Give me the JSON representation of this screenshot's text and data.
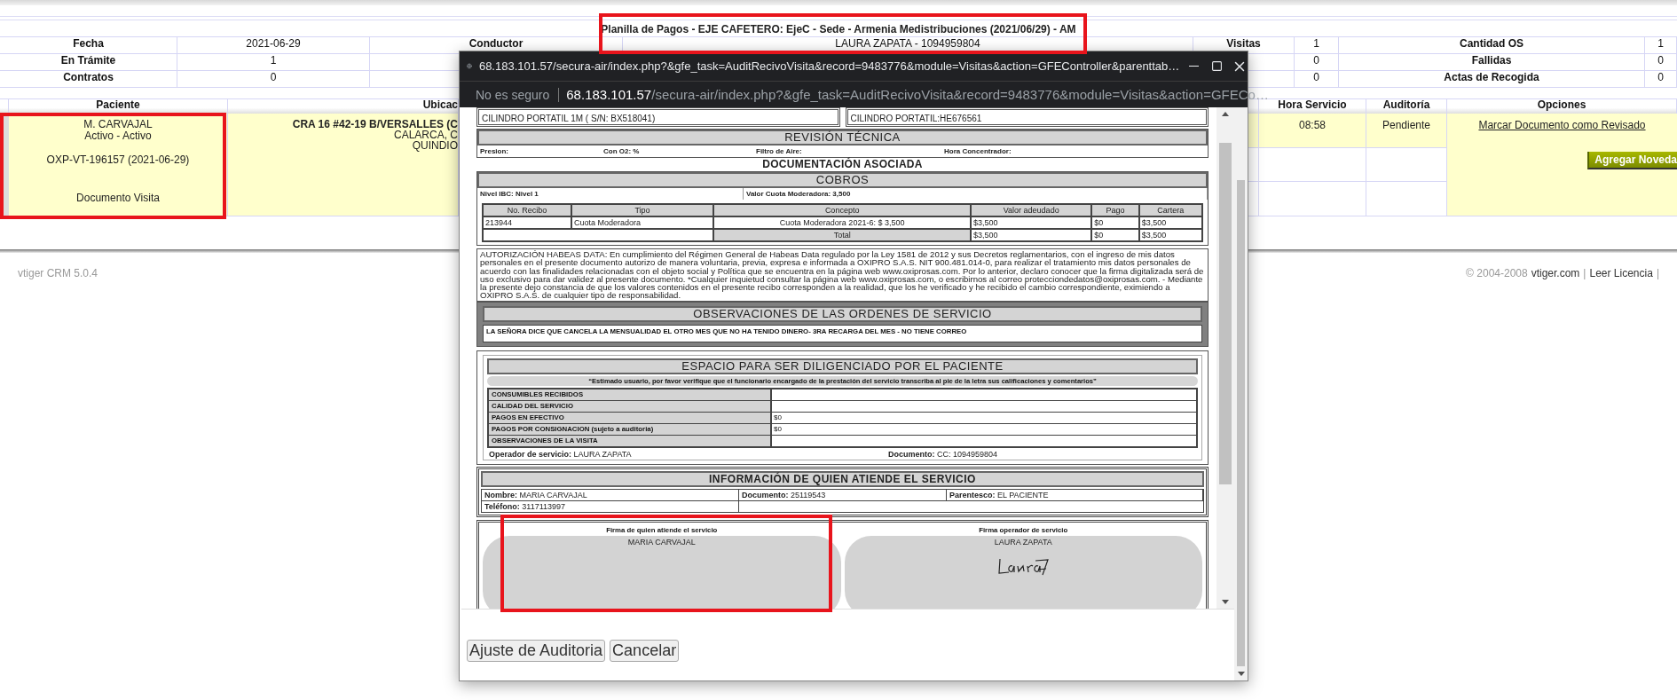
{
  "page_title": "Planilla de Pagos - EJE CAFETERO: EjeC - Sede - Armenia Medistribuciones (2021/06/29) - AM",
  "summary": {
    "rows": [
      {
        "label": "Fecha",
        "value": "2021-06-29",
        "label_2": "Conductor",
        "value_2": "LAURA ZAPATA - 1094959804",
        "label_3": "Visitas",
        "value_3": "1",
        "label_4": "Cantidad OS",
        "value_4": "1"
      },
      {
        "label": "En Trámite",
        "value": "1",
        "value_3": "0",
        "label_4": "Fallidas",
        "value_4": "0"
      },
      {
        "label": "Contratos",
        "value": "0",
        "value_3": "0",
        "label_4": "Actas de Recogida",
        "value_4": "0"
      }
    ]
  },
  "visits": {
    "columns": {
      "patient": "Paciente",
      "location": "Ubicac",
      "time": "Hora Servicio",
      "audit": "Auditoría",
      "options": "Opciones"
    },
    "row": {
      "patient": [
        "M. CARVAJAL",
        "Activo - Activo",
        "OXP-VT-196157 (2021-06-29)"
      ],
      "document_label": "Documento Visita",
      "address": [
        "CRA 16 #42-19 B/VERSALLES (C",
        "CALARCA, C",
        "QUINDIO"
      ],
      "time": "08:58",
      "audit": "Pendiente",
      "review_link": "Marcar Documento como Revisado",
      "add_button": "Agregar Noveda"
    }
  },
  "footer": {
    "version": "vtiger CRM 5.0.4",
    "right": [
      {
        "kind": "text",
        "text": "© 2004-2008"
      },
      {
        "kind": "link",
        "text": "vtiger.com"
      },
      {
        "kind": "text",
        "text": "|"
      },
      {
        "kind": "link",
        "text": "Leer Licencia"
      },
      {
        "kind": "text",
        "text": "|"
      }
    ]
  },
  "popup": {
    "title_url": "68.183.101.57/secura-air/index.php?&gfe_task=AuditRecivoVisita&record=9483776&module=Visitas&action=GFEController&parenttab…",
    "security": "No es seguro",
    "address_host": "68.183.101.57",
    "address_path": "/secura-air/index.php?&gfe_task=AuditRecivoVisita&record=9483776&module=Visitas&action=GFECo…",
    "document": {
      "equipment": [
        "CILINDRO PORTATIL 1M ( S/N: BX518041)",
        "CILINDRO PORTATIL:HE676561"
      ],
      "technical": {
        "title": "REVISIÓN TÉCNICA",
        "fields": [
          "Presion:",
          "Con O2: %",
          "Filtro de Aire:",
          "Hora Concentrador:"
        ]
      },
      "docs_title": "DOCUMENTACIÓN ASOCIADA",
      "charges": {
        "title": "COBROS",
        "level": "Nivel IBC: Nivel 1",
        "fee": "Valor Cuota Moderadora: 3,500",
        "columns": [
          "No. Recibo",
          "Tipo",
          "Concepto",
          "Valor adeudado",
          "Pago",
          "Cartera"
        ],
        "rows": [
          [
            "213944",
            "Cuota Moderadora",
            "Cuota Moderadora 2021-6: $ 3,500",
            "$3,500",
            "$0",
            "$3,500"
          ]
        ],
        "total": {
          "label": "Total",
          "values": [
            "$3,500",
            "$0",
            "$3,500"
          ]
        }
      },
      "consent": "AUTORIZACIÓN HABEAS DATA: En cumplimiento del Régimen General de Habeas Data regulado por la Ley 1581 de 2012 y sus Decretos reglamentarios, con el ingreso de mis datos personales en el presente documento autorizo de manera voluntaria, previa, expresa e informada a OXIPRO S.A.S. NIT 900.481.014-0, para realizar el tratamiento mis datos personales de acuerdo con las finalidades relacionadas con el objeto social y Política que se encuentra en la página web www.oxiprosas.com. Por lo anterior, declaro conocer que la firma digitalizada será de uso exclusivo para dar validez al presente documento. *Cualquier inquietud consultar la página web www.oxiprosas.com, o escribirnos al correo protecciondedatos@oxiprosas.com. - Mediante la presente dejo constancia de que los valores contenidos en el presente recibo corresponden a la realidad, que los he verificado y he recibido el cambio correspondiente, eximiendo a OXIPRO S.A.S. de cualquier tipo de responsabilidad.",
      "observations": {
        "title": "OBSERVACIONES DE LAS ORDENES DE SERVICIO",
        "text": "LA SEÑORA DICE QUE CANCELA LA MENSUALIDAD EL OTRO MES QUE NO HA TENIDO DINERO- 3RA RECARGA DEL MES - NO TIENE CORREO"
      },
      "patient_form": {
        "title": "ESPACIO PARA SER DILIGENCIADO POR EL PACIENTE",
        "note": "“Estimado usuario, por favor verifique que el funcionario encargado de la prestación del servicio transcriba al pie de la letra sus calificaciones y comentarios”",
        "rows": [
          {
            "label": "CONSUMIBLES RECIBIDOS"
          },
          {
            "label": "CALIDAD DEL SERVICIO"
          },
          {
            "label": "PAGOS EN EFECTIVO",
            "value": "$0"
          },
          {
            "label": "PAGOS POR CONSIGNACION (sujeto a auditoria)",
            "value": "$0"
          },
          {
            "label": "OBSERVACIONES DE LA VISITA"
          }
        ],
        "operator": "**Operador de servicio:** LAURA ZAPATA",
        "document": "**Documento:** CC: 1094959804"
      },
      "attendee": {
        "title": "INFORMACIÓN DE QUIEN ATIENDE EL SERVICIO",
        "fields": [
          "**Nombre:** MARIA CARVAJAL",
          "**Documento:** 25119543",
          "**Parentesco:** EL PACIENTE"
        ],
        "phone": "**Teléfono:** 3117113997"
      },
      "signatures": [
        {
          "caption": "Firma de quien atiende el servicio",
          "name": "MARIA CARVAJAL",
          "signed": false
        },
        {
          "caption": "Firma operador de servicio",
          "name": "LAURA ZAPATA",
          "signed": true
        }
      ]
    },
    "buttons": [
      "Ajuste de Auditoria",
      "Cancelar"
    ]
  }
}
